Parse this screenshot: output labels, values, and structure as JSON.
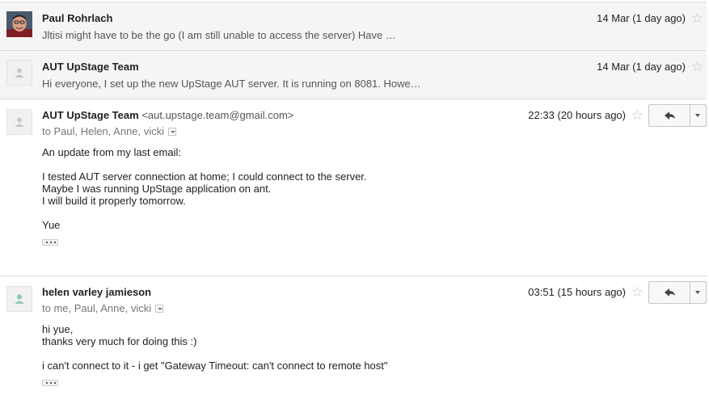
{
  "messages": [
    {
      "sender": "Paul Rohrlach",
      "date": "14 Mar (1 day ago)",
      "snippet": "Jltisi might have to be the go (I am still unable to access the server) Have …"
    },
    {
      "sender": "AUT UpStage Team",
      "date": "14 Mar (1 day ago)",
      "snippet": "Hi everyone, I set up the new UpStage AUT server. It is running on 8081. Howe…"
    },
    {
      "sender": "AUT UpStage Team",
      "email": "<aut.upstage.team@gmail.com>",
      "date": "22:33 (20 hours ago)",
      "to": "to Paul, Helen, Anne, vicki",
      "body": [
        "An update from my last email:",
        "I tested AUT server connection at home; I could connect to the server.",
        "Maybe I was running UpStage application on ant.",
        "I will build it properly tomorrow.",
        "Yue"
      ]
    },
    {
      "sender": "helen varley jamieson",
      "date": "03:51 (15 hours ago)",
      "to": "to me, Paul, Anne, vicki",
      "body": [
        "hi yue,",
        "thanks very much for doing this :)",
        "i can't connect to it - i get \"Gateway Timeout: can't connect to remote host\""
      ]
    }
  ],
  "icons": {
    "star": "star-outline-icon",
    "reply": "reply-arrow-icon",
    "more": "dropdown-caret-icon",
    "details": "details-dropdown-icon",
    "avatar_generic": "person-silhouette-icon",
    "trimmed": "show-trimmed-content-icon"
  },
  "colors": {
    "collapsed_background": "#f5f5f5",
    "divider": "#dcdcdc",
    "star": "#c4c4c4",
    "secondary_text": "#555555",
    "generic_avatar_silhouette_gray": "#c8c8c8",
    "generic_avatar_silhouette_teal": "#8fc8b8"
  }
}
